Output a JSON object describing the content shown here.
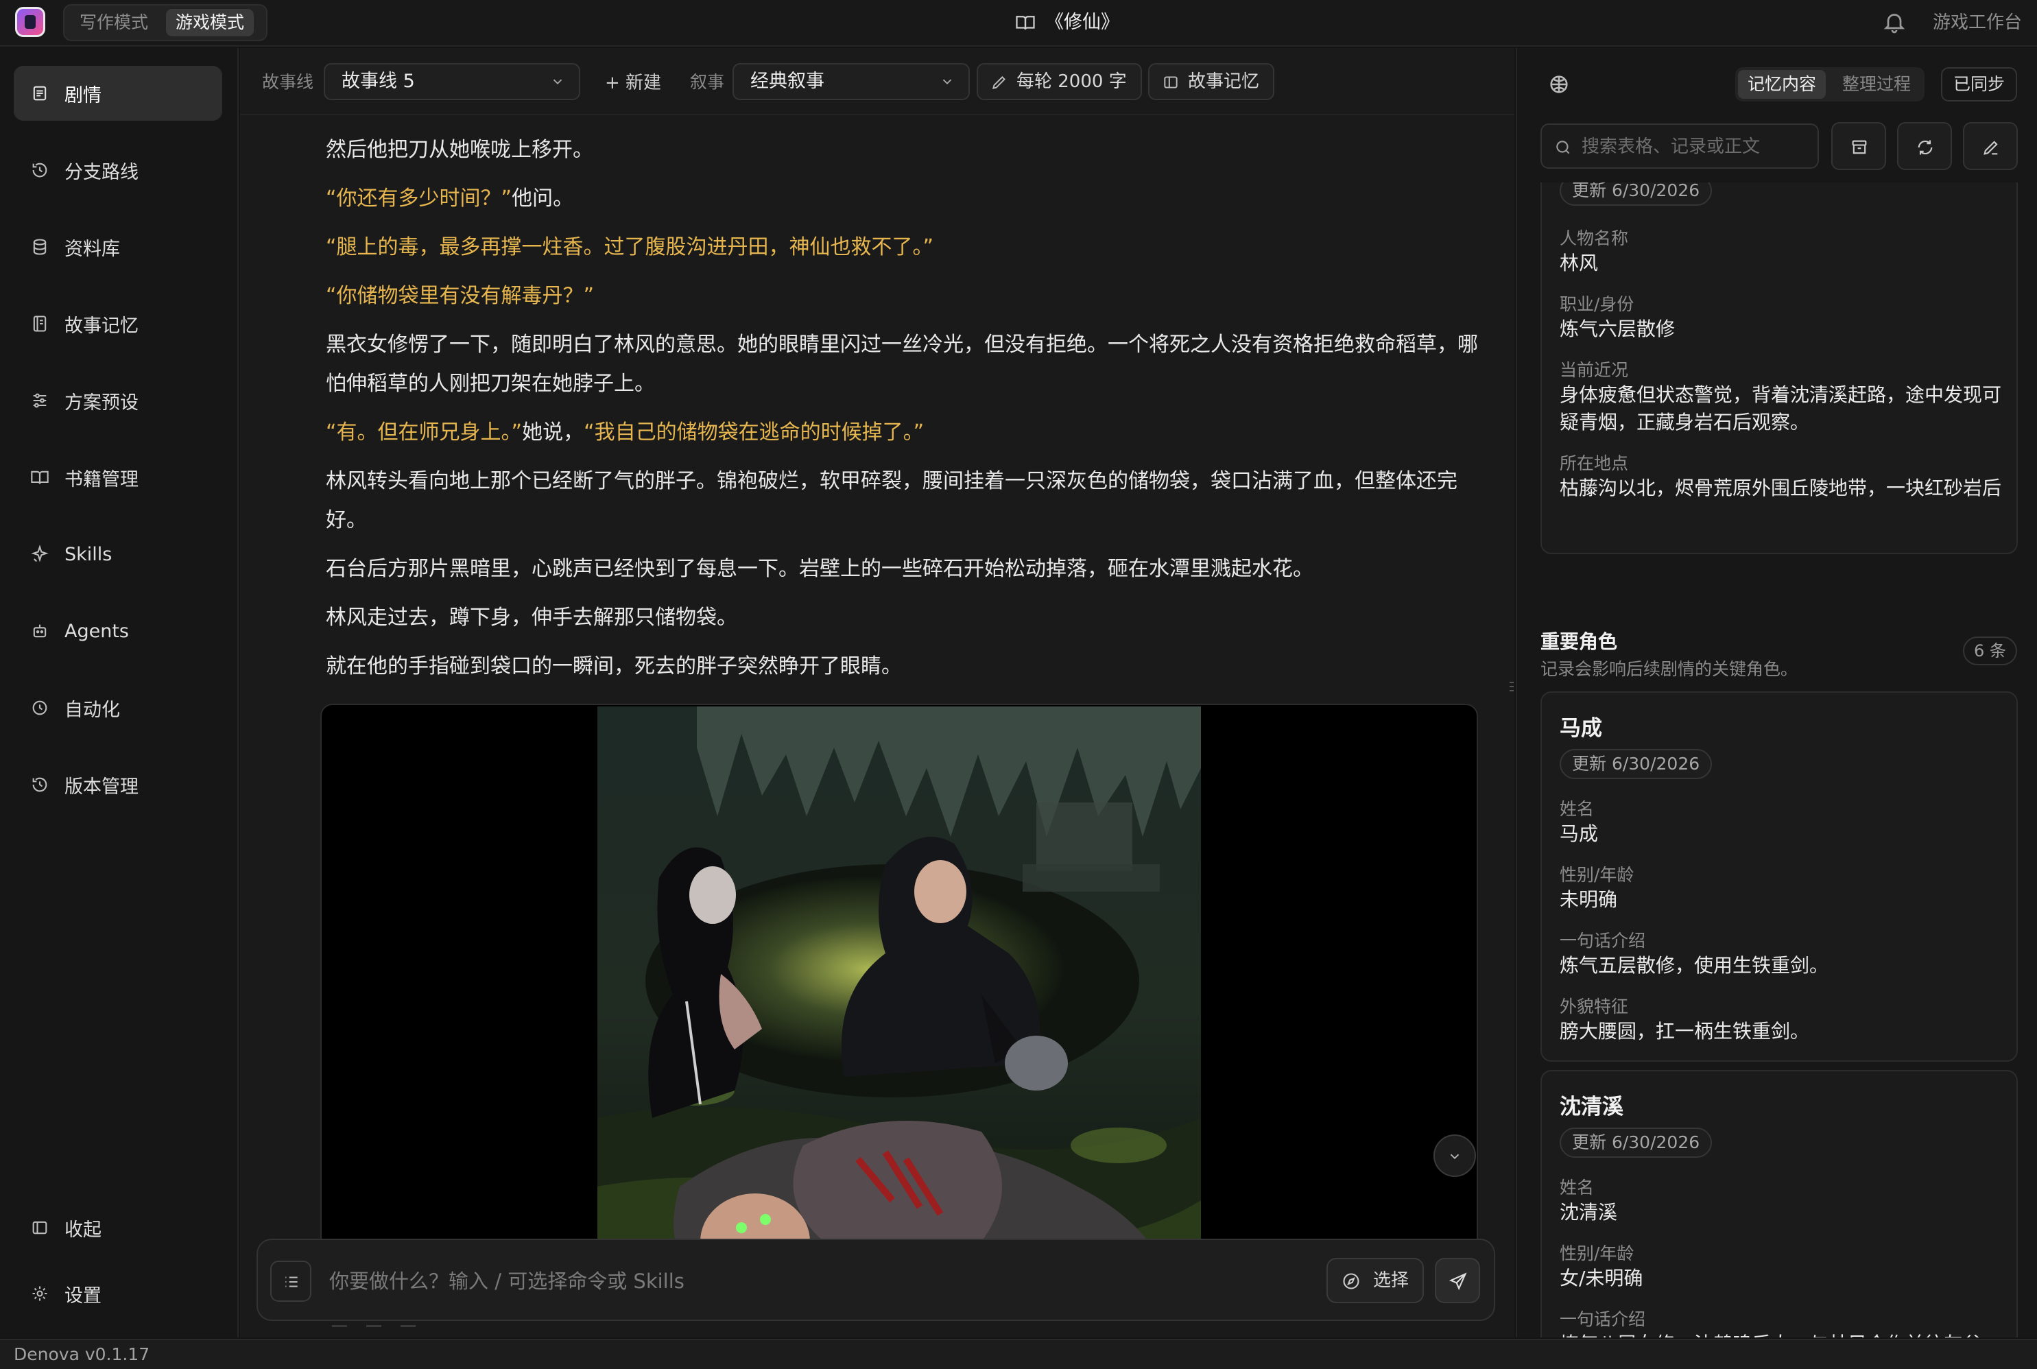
{
  "topbar": {
    "modes": [
      "写作模式",
      "游戏模式"
    ],
    "active_mode": "游戏模式",
    "title": "《修仙》",
    "workbench": "游戏工作台"
  },
  "sidebar": {
    "items": [
      {
        "label": "剧情",
        "icon": "document-icon",
        "active": true
      },
      {
        "label": "分支路线",
        "icon": "history-icon"
      },
      {
        "label": "资料库",
        "icon": "database-icon"
      },
      {
        "label": "故事记忆",
        "icon": "notebook-icon"
      },
      {
        "label": "方案预设",
        "icon": "sliders-icon"
      },
      {
        "label": "书籍管理",
        "icon": "book-icon"
      },
      {
        "label": "Skills",
        "icon": "sparkle-icon"
      },
      {
        "label": "Agents",
        "icon": "bot-icon"
      },
      {
        "label": "自动化",
        "icon": "clock-icon"
      },
      {
        "label": "版本管理",
        "icon": "history-icon"
      }
    ],
    "collapse": "收起",
    "settings": "设置"
  },
  "toolbar": {
    "storyline_label": "故事线",
    "storyline_value": "故事线 5",
    "new_label": "+ 新建",
    "narrative_label": "叙事",
    "narrative_value": "经典叙事",
    "words_per_turn": "每轮 2000 字",
    "story_memory": "故事记忆"
  },
  "story": {
    "paragraphs": [
      [
        {
          "t": "然后他把刀从她喉咙上移开。"
        }
      ],
      [
        {
          "t": "“你还有多少时间？”",
          "q": true
        },
        {
          "t": "他问。"
        }
      ],
      [
        {
          "t": "“腿上的毒，最多再撑一炷香。过了腹股沟进丹田，神仙也救不了。”",
          "q": true
        }
      ],
      [
        {
          "t": "“你储物袋里有没有解毒丹？”",
          "q": true
        }
      ],
      [
        {
          "t": "黑衣女修愣了一下，随即明白了林风的意思。她的眼睛里闪过一丝冷光，但没有拒绝。一个将死之人没有资格拒绝救命稻草，哪怕伸稻草的人刚把刀架在她脖子上。"
        }
      ],
      [
        {
          "t": "“有。但在师兄身上。”",
          "q": true
        },
        {
          "t": "她说，"
        },
        {
          "t": "“我自己的储物袋在逃命的时候掉了。”",
          "q": true
        }
      ],
      [
        {
          "t": "林风转头看向地上那个已经断了气的胖子。锦袍破烂，软甲碎裂，腰间挂着一只深灰色的储物袋，袋口沾满了血，但整体还完好。"
        }
      ],
      [
        {
          "t": "石台后方那片黑暗里，心跳声已经快到了每息一下。岩壁上的一些碎石开始松动掉落，砸在水潭里溅起水花。"
        }
      ],
      [
        {
          "t": "林风走过去，蹲下身，伸手去解那只储物袋。"
        }
      ],
      [
        {
          "t": "就在他的手指碰到袋口的一瞬间，死去的胖子突然睁开了眼睛。"
        }
      ]
    ]
  },
  "composer": {
    "placeholder": "你要做什么？输入 / 可选择命令或 Skills",
    "choose": "选择"
  },
  "panel": {
    "tabs": [
      "记忆内容",
      "整理过程"
    ],
    "active_tab": "记忆内容",
    "synced": "已同步",
    "search_placeholder": "搜索表格、记录或正文",
    "protagonist": {
      "updated": "更新 6/30/2026",
      "fields": [
        {
          "label": "人物名称",
          "value": "林风"
        },
        {
          "label": "职业/身份",
          "value": "炼气六层散修"
        },
        {
          "label": "当前近况",
          "value": "身体疲惫但状态警觉，背着沈清溪赶路，途中发现可疑青烟，正藏身岩石后观察。"
        },
        {
          "label": "所在地点",
          "value": "枯藤沟以北，烬骨荒原外围丘陵地带，一块红砂岩后"
        }
      ]
    },
    "section": {
      "title": "重要角色",
      "subtitle": "记录会影响后续剧情的关键角色。",
      "count": "6 条"
    },
    "characters": [
      {
        "name": "马成",
        "updated": "更新 6/30/2026",
        "fields": [
          {
            "label": "姓名",
            "value": "马成"
          },
          {
            "label": "性别/年龄",
            "value": "未明确"
          },
          {
            "label": "一句话介绍",
            "value": "炼气五层散修，使用生铁重剑。"
          },
          {
            "label": "外貌特征",
            "value": "膀大腰圆，扛一柄生铁重剑。"
          }
        ]
      },
      {
        "name": "沈清溪",
        "updated": "更新 6/30/2026",
        "fields": [
          {
            "label": "姓名",
            "value": "沈清溪"
          },
          {
            "label": "性别/年龄",
            "value": "女/未明确"
          },
          {
            "label": "一句话介绍",
            "value": "炼气八层女修，沈鹤鸣后人，与林风合作前往灰谷集。"
          }
        ]
      }
    ]
  },
  "status": {
    "version": "Denova v0.1.17"
  },
  "colors": {
    "background": "#141414",
    "quote": "#e7b64f",
    "active_nav": "#2e2e2e"
  }
}
